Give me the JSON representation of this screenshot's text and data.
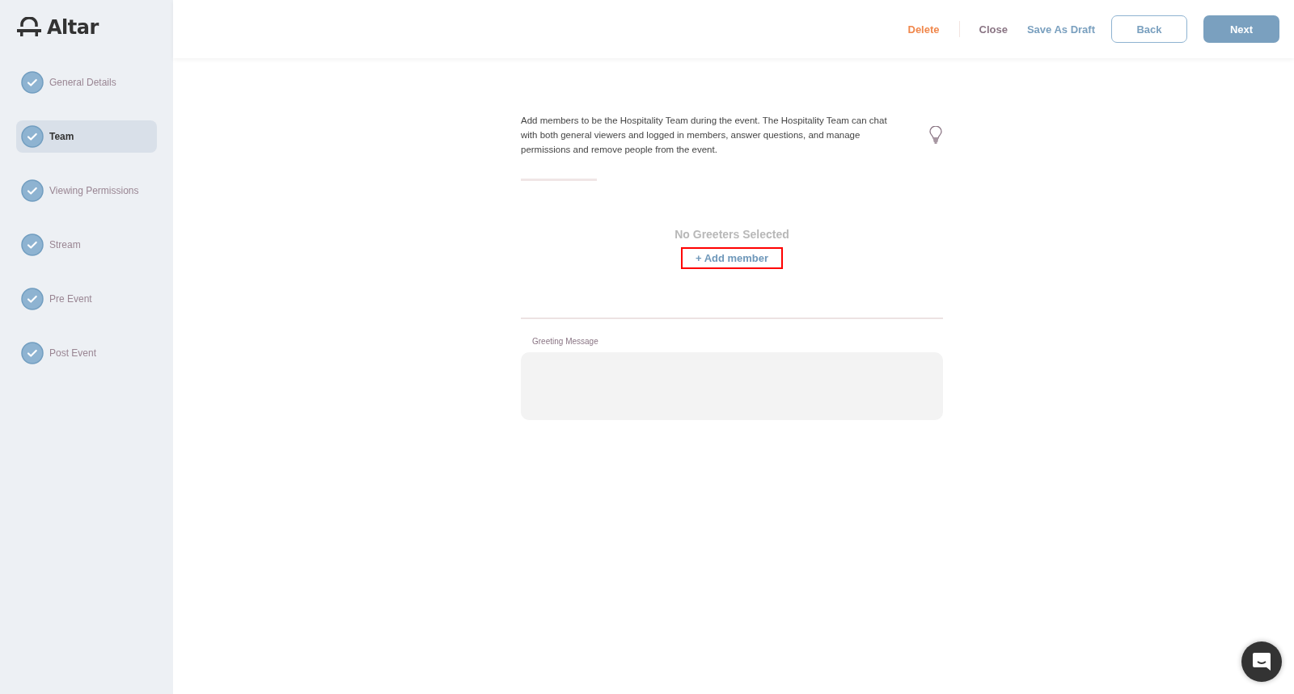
{
  "logo": {
    "text": "Altar"
  },
  "steps": [
    {
      "label": "General Details",
      "completed": true,
      "selected": false
    },
    {
      "label": "Team",
      "completed": true,
      "selected": true
    },
    {
      "label": "Viewing Permissions",
      "completed": true,
      "selected": false
    },
    {
      "label": "Stream",
      "completed": true,
      "selected": false
    },
    {
      "label": "Pre Event",
      "completed": true,
      "selected": false
    },
    {
      "label": "Post Event",
      "completed": true,
      "selected": false
    }
  ],
  "header": {
    "actions": [
      {
        "label": "Delete",
        "kind": "danger"
      },
      {
        "label": "Close",
        "kind": "muted"
      },
      {
        "label": "Save As Draft",
        "kind": "link"
      },
      {
        "label": "Back",
        "kind": "outline"
      },
      {
        "label": "Next",
        "kind": "primary"
      }
    ]
  },
  "intro": "Add members to be the Hospitality Team during the event. The Hospitality Team can chat with both general viewers and logged in members, answer questions, and manage permissions and remove people from the event.",
  "team": {
    "empty_text": "No Greeters Selected",
    "add_button": {
      "label": "+ Add member",
      "highlighted": true
    }
  },
  "greeting": {
    "label": "Greeting Message"
  }
}
